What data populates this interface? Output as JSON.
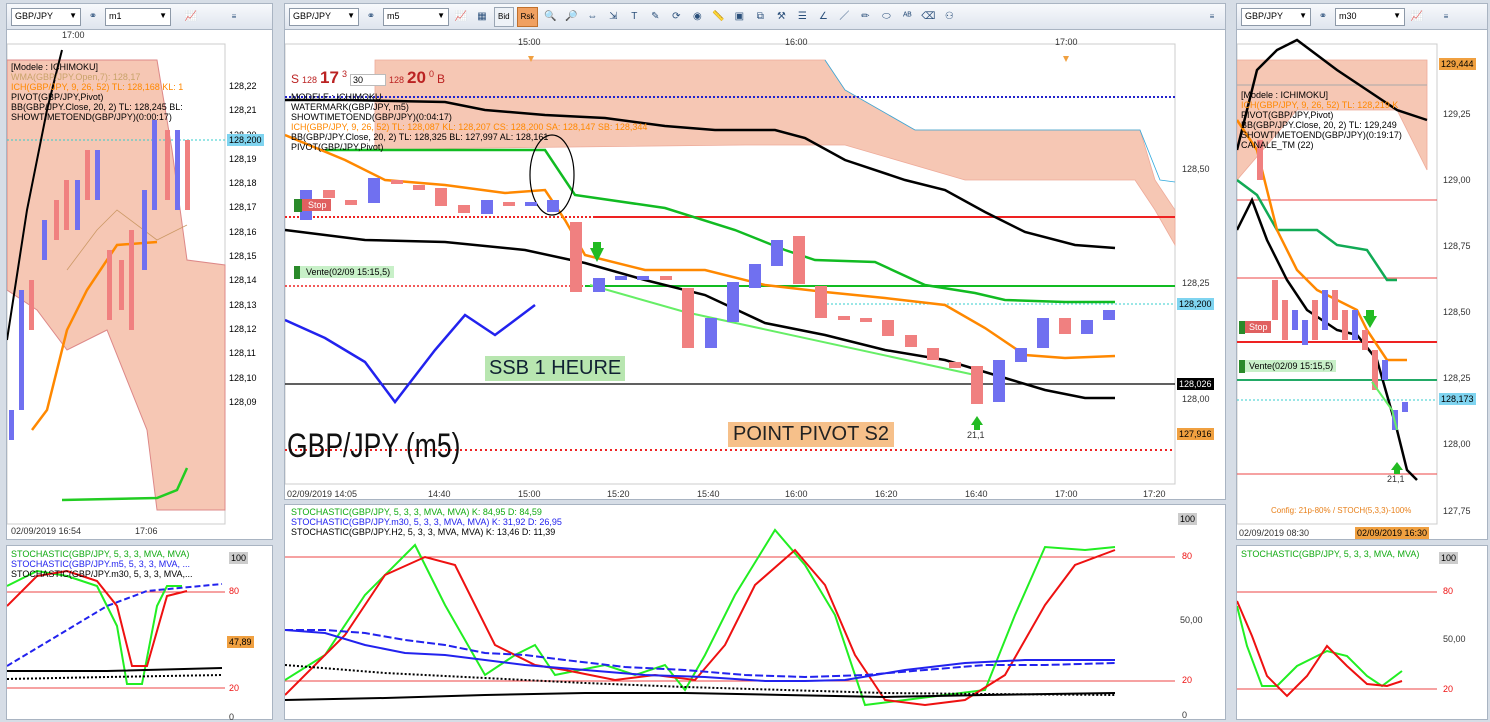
{
  "panels": {
    "left_m1": {
      "symbol": "GBP/JPY",
      "timeframe": "m1",
      "time_top": "17:00",
      "legend": [
        "[Modele : ICHIMOKU]",
        "WMA(GBP/JPY.Open,7): 128,17",
        "ICH(GBP/JPY, 9, 26, 52)  TL: 128,168  KL: 1",
        "PIVOT(GBP/JPY,Pivot)",
        "BB(GBP/JPY.Close, 20, 2)  TL: 128,245  BL:",
        "SHOWTIMETOEND(GBP/JPY)(0:00:17)"
      ],
      "y_ticks": [
        "128,22",
        "128,21",
        "128,20",
        "128,19",
        "128,18",
        "128,17",
        "128,16",
        "128,15",
        "128,14",
        "128,13",
        "128,12",
        "128,11",
        "128,10",
        "128,09"
      ],
      "price_tag": "128,200",
      "x_ticks": [
        "02/09/2019 16:54",
        "17:06"
      ]
    },
    "left_stoch": {
      "legend": [
        "STOCHASTIC(GBP/JPY, 5, 3, 3, MVA, MVA)",
        "STOCHASTIC(GBP/JPY.m5, 5, 3, 3, MVA, ...",
        "STOCHASTIC(GBP/JPY.m30, 5, 3, 3, MVA,..."
      ],
      "y_ticks": [
        "100",
        "80",
        "20",
        "0"
      ],
      "tag": "47,89"
    },
    "main_m5": {
      "symbol": "GBP/JPY",
      "timeframe": "m5",
      "bid_label": "Bid",
      "ask_label": "Rsk",
      "time_top": [
        "15:00",
        "16:00",
        "17:00"
      ],
      "spread": {
        "s_label": "S",
        "b_label": "B",
        "left_small": "128",
        "left_big": "17",
        "left_sup": "3",
        "qty": "30",
        "right_small": "128",
        "right_big": "20",
        "right_sup": "0"
      },
      "legend": [
        "MODELE : ICHIMOKU",
        "WATERMARK(GBP/JPY, m5)",
        "SHOWTIMETOEND(GBP/JPY)(0:04:17)",
        "ICH(GBP/JPY, 9, 26, 52)  TL: 128,087  KL: 128,207  CS: 128,200  SA: 128,147  SB: 128,344",
        "BB(GBP/JPY.Close, 20, 2)  TL: 128,325  BL: 127,997  AL: 128,161",
        "PIVOT(GBP/JPY,Pivot)"
      ],
      "stop_label": "Stop",
      "vente_label": "Vente(02/09 15:15,5)",
      "ssb_label": "SSB 1 HEURE",
      "pivot_label": "POINT PIVOT S2",
      "watermark": "GBP/JPY (m5)",
      "arrow_value": "21,1",
      "y_ticks": [
        "128,50",
        "128,25",
        "128,00"
      ],
      "tags": {
        "cyan": "128,200",
        "black": "128,026",
        "orange": "127,916"
      },
      "x_ticks": [
        "02/09/2019 14:05",
        "14:40",
        "15:00",
        "15:20",
        "15:40",
        "16:00",
        "16:20",
        "16:40",
        "17:00",
        "17:20"
      ]
    },
    "main_stoch": {
      "legend": [
        "STOCHASTIC(GBP/JPY, 5, 3, 3, MVA, MVA)  K: 84,95  D: 84,59",
        "STOCHASTIC(GBP/JPY.m30, 5, 3, 3, MVA, MVA)  K: 31,92  D: 26,95",
        "STOCHASTIC(GBP/JPY.H2, 5, 3, 3, MVA, MVA)  K: 13,46  D: 11,39"
      ],
      "y_ticks": [
        "100",
        "80",
        "50,00",
        "20",
        "0"
      ]
    },
    "right_m30": {
      "symbol": "GBP/JPY",
      "timeframe": "m30",
      "legend": [
        "[Modele : ICHIMOKU]",
        "ICH(GBP/JPY, 9, 26, 52)  TL: 128,219  K",
        "PIVOT(GBP/JPY,Pivot)",
        "BB(GBP/JPY.Close, 20, 2)  TL: 129,249",
        "SHOWTIMETOEND(GBP/JPY)(0:19:17)",
        "CANALE_TM (22)"
      ],
      "y_ticks": [
        "129,25",
        "129,00",
        "128,75",
        "128,50",
        "128,25",
        "128,00",
        "127,75"
      ],
      "tags": {
        "top": "129,444",
        "cyan": "128,173"
      },
      "stop_label": "Stop",
      "vente_label": "Vente(02/09 15:15,5)",
      "arrow_value": "21,1",
      "config": "Config: 21p-80% / STOCH(5,3,3)-100%",
      "x_ticks": [
        "02/09/2019 08:30",
        "02/09/2019 16:30"
      ]
    },
    "right_stoch": {
      "legend": [
        "STOCHASTIC(GBP/JPY, 5, 3, 3, MVA, MVA)"
      ],
      "y_ticks": [
        "100",
        "80",
        "50,00",
        "20"
      ]
    }
  },
  "colors": {
    "cloud": "#f6c7b4",
    "stoch_k": "#22ee22",
    "stoch_d": "#ee1111",
    "accent_tab": "#f0a060"
  }
}
